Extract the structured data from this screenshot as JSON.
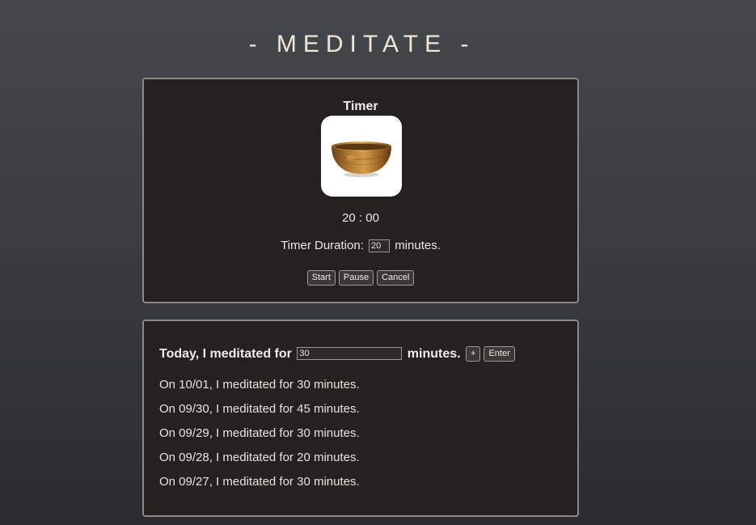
{
  "page": {
    "title": "- MEDITATE -"
  },
  "timer": {
    "heading": "Timer",
    "countdown": "20 : 00",
    "duration_prefix": "Timer Duration:",
    "duration_value": "20",
    "duration_suffix": "minutes.",
    "image": "singing-bowl",
    "buttons": {
      "start": "Start",
      "pause": "Pause",
      "cancel": "Cancel"
    }
  },
  "log": {
    "prefix": "Today, I meditated for",
    "input_value": "30",
    "suffix": "minutes.",
    "plus_label": "+",
    "enter_label": "Enter",
    "entries": [
      "On 10/01, I meditated for 30 minutes.",
      "On 09/30, I meditated for 45 minutes.",
      "On 09/29, I meditated for 30 minutes.",
      "On 09/28, I meditated for 20 minutes.",
      "On 09/27, I meditated for 30 minutes."
    ]
  },
  "colors": {
    "panel_background": "#252120",
    "panel_border": "#8c8a88",
    "title_color": "#efe6d6",
    "bowl_bronze": "#a8742e"
  }
}
